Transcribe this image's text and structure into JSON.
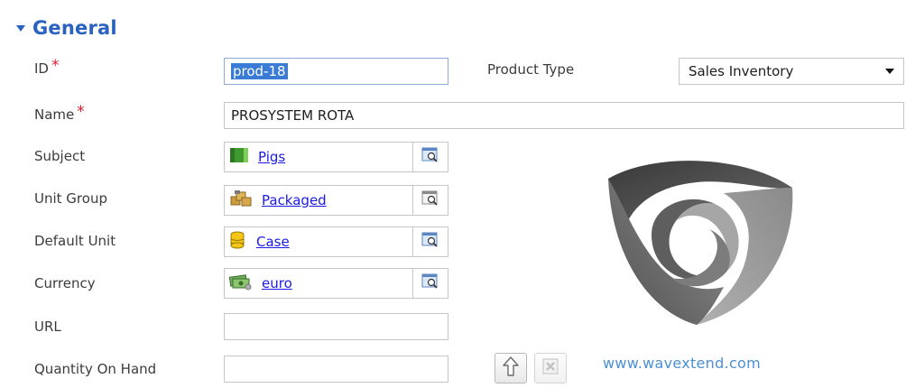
{
  "section": {
    "title": "General"
  },
  "fields": {
    "id": {
      "label": "ID",
      "value": "prod-18"
    },
    "product_type": {
      "label": "Product Type",
      "value": "Sales Inventory"
    },
    "name": {
      "label": "Name",
      "value": "PROSYSTEM ROTA"
    },
    "subject": {
      "label": "Subject",
      "value": "Pigs",
      "icon": "book-icon"
    },
    "unit_group": {
      "label": "Unit Group",
      "value": "Packaged",
      "icon": "boxes-icon"
    },
    "default_unit": {
      "label": "Default Unit",
      "value": "Case",
      "icon": "database-icon"
    },
    "currency": {
      "label": "Currency",
      "value": "euro",
      "icon": "money-icon"
    },
    "url": {
      "label": "URL",
      "value": ""
    },
    "quantity_on_hand": {
      "label": "Quantity On Hand",
      "value": ""
    }
  },
  "required_marker": "*",
  "image_buttons": {
    "upload_icon": "upload-arrow-icon",
    "remove_icon": "remove-image-icon"
  },
  "website": "www.wavextend.com",
  "colors": {
    "accent": "#2b62c0",
    "required": "#e0192c",
    "link": "#1a1ae6",
    "website": "#4b8fd6"
  }
}
